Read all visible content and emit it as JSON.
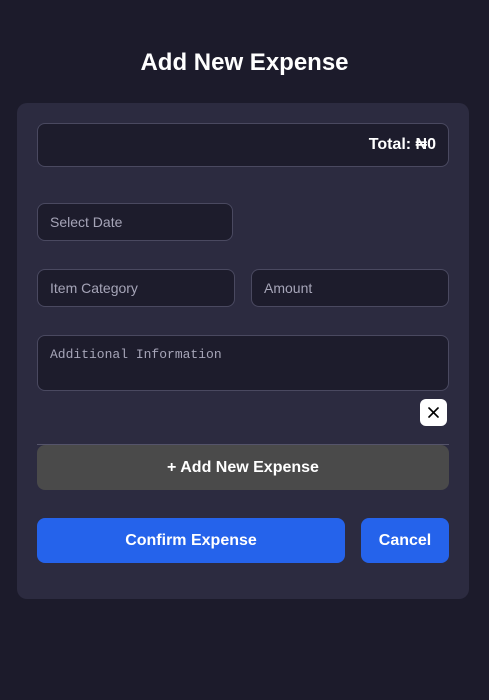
{
  "page": {
    "title": "Add New Expense"
  },
  "form": {
    "total_label": "Total: ₦0",
    "date_placeholder": "Select Date",
    "category_placeholder": "Item Category",
    "amount_placeholder": "Amount",
    "info_placeholder": "Additional Information",
    "remove_icon": "close-icon"
  },
  "actions": {
    "add_label": "+ Add New Expense",
    "confirm_label": "Confirm Expense",
    "cancel_label": "Cancel"
  },
  "colors": {
    "background": "#1c1b2b",
    "card": "#2c2b40",
    "input_bg": "#1d1c2c",
    "primary": "#2563eb",
    "secondary_button": "#4a4a4a"
  }
}
